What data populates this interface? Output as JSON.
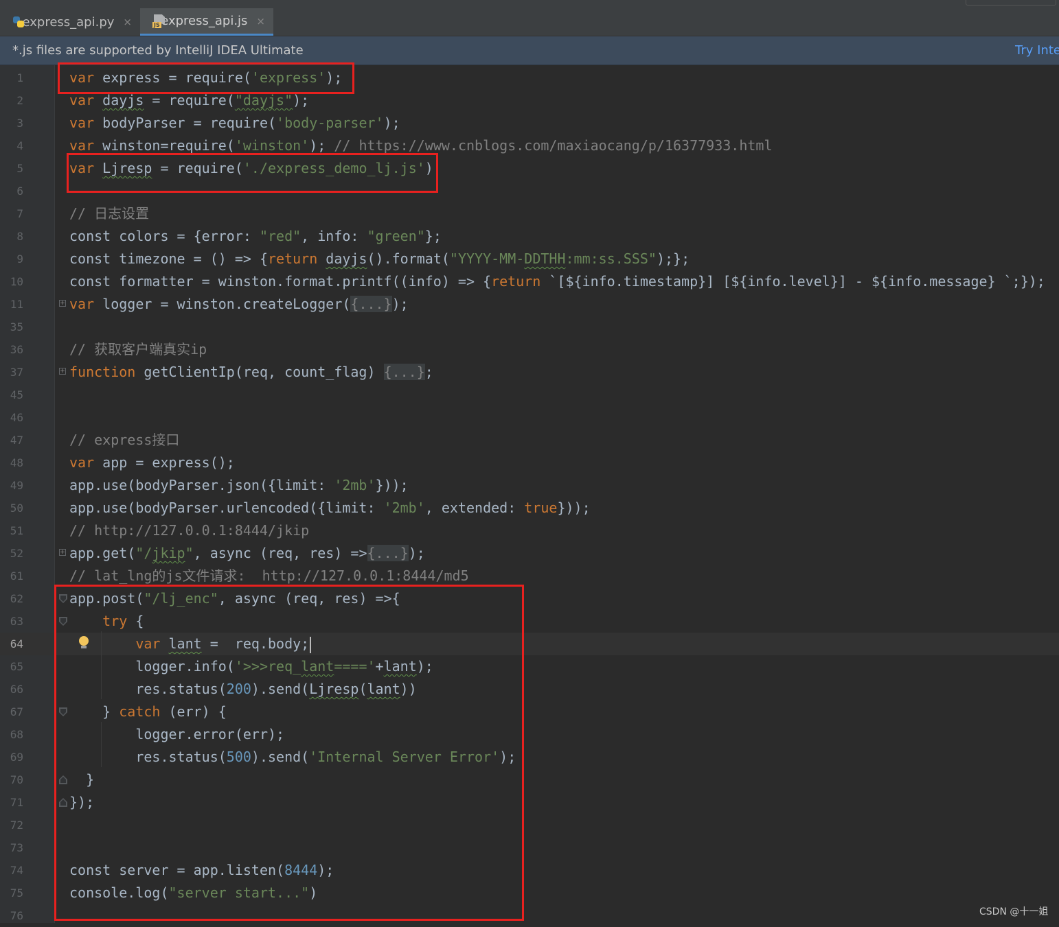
{
  "tabs": [
    {
      "label": "express_api.py",
      "icon": "python-file-icon",
      "active": false
    },
    {
      "label": "express_api.js",
      "icon": "javascript-file-icon",
      "active": true
    }
  ],
  "tab_close_glyph": "×",
  "banner": {
    "message": "*.js files are supported by IntelliJ IDEA Ultimate",
    "action": "Try Inte"
  },
  "editor": {
    "current_line": "64",
    "lines": [
      {
        "n": "1",
        "code": [
          {
            "t": "var",
            "c": "kw"
          },
          {
            "t": " express = require("
          },
          {
            "t": "'express'",
            "c": "str"
          },
          {
            "t": ");"
          }
        ]
      },
      {
        "n": "2",
        "code": [
          {
            "t": "var",
            "c": "kw"
          },
          {
            "t": " "
          },
          {
            "t": "dayjs",
            "c": "sq"
          },
          {
            "t": " = require("
          },
          {
            "t": "\"dayjs\"",
            "c": "str sq"
          },
          {
            "t": ");"
          }
        ]
      },
      {
        "n": "3",
        "code": [
          {
            "t": "var",
            "c": "kw"
          },
          {
            "t": " bodyParser = require("
          },
          {
            "t": "'body-parser'",
            "c": "str"
          },
          {
            "t": ");"
          }
        ]
      },
      {
        "n": "4",
        "code": [
          {
            "t": "var",
            "c": "kw"
          },
          {
            "t": " winston=require("
          },
          {
            "t": "'winston'",
            "c": "str"
          },
          {
            "t": "); "
          },
          {
            "t": "// https://www.cnblogs.com/maxiaocang/p/16377933.html",
            "c": "cmt"
          }
        ]
      },
      {
        "n": "5",
        "code": [
          {
            "t": "var",
            "c": "kw"
          },
          {
            "t": " "
          },
          {
            "t": "Ljresp",
            "c": "sq"
          },
          {
            "t": " = require("
          },
          {
            "t": "'./express_demo_lj.js'",
            "c": "str"
          },
          {
            "t": ")"
          }
        ]
      },
      {
        "n": "6",
        "code": []
      },
      {
        "n": "7",
        "code": [
          {
            "t": "// 日志设置",
            "c": "cmt"
          }
        ]
      },
      {
        "n": "8",
        "code": [
          {
            "t": "const colors = {error: "
          },
          {
            "t": "\"red\"",
            "c": "str"
          },
          {
            "t": ", info: "
          },
          {
            "t": "\"green\"",
            "c": "str"
          },
          {
            "t": "};"
          }
        ]
      },
      {
        "n": "9",
        "code": [
          {
            "t": "const timezone = () => {"
          },
          {
            "t": "return",
            "c": "kw"
          },
          {
            "t": " "
          },
          {
            "t": "dayjs",
            "c": "sq"
          },
          {
            "t": "().format("
          },
          {
            "t": "\"YYYY-MM-",
            "c": "str"
          },
          {
            "t": "DDTHH",
            "c": "str sq"
          },
          {
            "t": ":mm:ss.SSS\"",
            "c": "str"
          },
          {
            "t": ");};"
          }
        ]
      },
      {
        "n": "10",
        "code": [
          {
            "t": "const formatter = winston.format.printf((info) => {"
          },
          {
            "t": "return",
            "c": "kw"
          },
          {
            "t": " `[${info.timestamp}] [${info.level}] - ${info.message} `;});"
          }
        ]
      },
      {
        "n": "11",
        "fold": "plus",
        "code": [
          {
            "t": "var",
            "c": "kw"
          },
          {
            "t": " logger = winston.createLogger("
          },
          {
            "t": "{...}",
            "c": "fh cmt"
          },
          {
            "t": ");"
          }
        ]
      },
      {
        "n": "35",
        "code": []
      },
      {
        "n": "36",
        "code": [
          {
            "t": "// 获取客户端真实ip",
            "c": "cmt"
          }
        ]
      },
      {
        "n": "37",
        "fold": "plus",
        "code": [
          {
            "t": "function",
            "c": "kw"
          },
          {
            "t": " getClientIp(req, count_flag) "
          },
          {
            "t": "{...}",
            "c": "fh cmt"
          },
          {
            "t": ";"
          }
        ]
      },
      {
        "n": "45",
        "code": []
      },
      {
        "n": "46",
        "code": []
      },
      {
        "n": "47",
        "code": [
          {
            "t": "// express接口",
            "c": "cmt"
          }
        ]
      },
      {
        "n": "48",
        "code": [
          {
            "t": "var",
            "c": "kw"
          },
          {
            "t": " app = express();"
          }
        ]
      },
      {
        "n": "49",
        "code": [
          {
            "t": "app.use(bodyParser.json({limit: "
          },
          {
            "t": "'2mb'",
            "c": "str"
          },
          {
            "t": "}));"
          }
        ]
      },
      {
        "n": "50",
        "code": [
          {
            "t": "app.use(bodyParser.urlencoded({limit: "
          },
          {
            "t": "'2mb'",
            "c": "str"
          },
          {
            "t": ", extended: "
          },
          {
            "t": "true",
            "c": "kw"
          },
          {
            "t": "}));"
          }
        ]
      },
      {
        "n": "51",
        "code": [
          {
            "t": "// http://127.0.0.1:8444/jkip",
            "c": "cmt"
          }
        ]
      },
      {
        "n": "52",
        "fold": "plus",
        "code": [
          {
            "t": "app.get("
          },
          {
            "t": "\"/",
            "c": "str"
          },
          {
            "t": "jkip",
            "c": "str sq"
          },
          {
            "t": "\"",
            "c": "str"
          },
          {
            "t": ", async (req, res) =>"
          },
          {
            "t": "{...}",
            "c": "fh cmt"
          },
          {
            "t": ");"
          }
        ]
      },
      {
        "n": "61",
        "code": [
          {
            "t": "// lat_lng的js文件请求:  http://127.0.0.1:8444/md5",
            "c": "cmt"
          }
        ]
      },
      {
        "n": "62",
        "fold": "down",
        "code": [
          {
            "t": "app.post("
          },
          {
            "t": "\"/lj_enc\"",
            "c": "str"
          },
          {
            "t": ", async (req, res) =>{"
          }
        ]
      },
      {
        "n": "63",
        "fold": "down",
        "code": [
          {
            "t": "    "
          },
          {
            "t": "try",
            "c": "kw"
          },
          {
            "t": " {"
          }
        ]
      },
      {
        "n": "64",
        "bulb": true,
        "caret": true,
        "code": [
          {
            "t": "        "
          },
          {
            "t": "var",
            "c": "kw"
          },
          {
            "t": " "
          },
          {
            "t": "lant",
            "c": "sq"
          },
          {
            "t": " =  req.body;"
          }
        ]
      },
      {
        "n": "65",
        "code": [
          {
            "t": "        logger.info("
          },
          {
            "t": "'>>>req_",
            "c": "str"
          },
          {
            "t": "lant",
            "c": "str sq"
          },
          {
            "t": "===='",
            "c": "str"
          },
          {
            "t": "+"
          },
          {
            "t": "lant",
            "c": "sq"
          },
          {
            "t": ");"
          }
        ]
      },
      {
        "n": "66",
        "code": [
          {
            "t": "        res.status("
          },
          {
            "t": "200",
            "c": "num"
          },
          {
            "t": ").send("
          },
          {
            "t": "Ljresp",
            "c": "sq"
          },
          {
            "t": "("
          },
          {
            "t": "lant",
            "c": "sq"
          },
          {
            "t": "))"
          }
        ]
      },
      {
        "n": "67",
        "fold": "down",
        "code": [
          {
            "t": "    } "
          },
          {
            "t": "catch",
            "c": "kw"
          },
          {
            "t": " (err) {"
          }
        ]
      },
      {
        "n": "68",
        "code": [
          {
            "t": "        logger.error(err);"
          }
        ]
      },
      {
        "n": "69",
        "code": [
          {
            "t": "        res.status("
          },
          {
            "t": "500",
            "c": "num"
          },
          {
            "t": ").send("
          },
          {
            "t": "'Internal Server Error'",
            "c": "str"
          },
          {
            "t": ");"
          }
        ]
      },
      {
        "n": "70",
        "fold": "up",
        "code": [
          {
            "t": "  }"
          }
        ]
      },
      {
        "n": "71",
        "fold": "up",
        "code": [
          {
            "t": "});"
          }
        ]
      },
      {
        "n": "72",
        "code": []
      },
      {
        "n": "73",
        "code": []
      },
      {
        "n": "74",
        "code": [
          {
            "t": "const server = app.listen("
          },
          {
            "t": "8444",
            "c": "num"
          },
          {
            "t": ");"
          }
        ]
      },
      {
        "n": "75",
        "code": [
          {
            "t": "console.log("
          },
          {
            "t": "\"server start...\"",
            "c": "str"
          },
          {
            "t": ")"
          }
        ]
      },
      {
        "n": "76",
        "code": []
      }
    ]
  },
  "colors": {
    "background": "#2b2b2b",
    "keyword": "#cc7832",
    "string": "#6a8759",
    "number": "#6897bb",
    "comment": "#808080",
    "text": "#a9b7c6",
    "highlight_box": "#e8211f",
    "link": "#589df6"
  },
  "watermark": "CSDN @十一姐"
}
